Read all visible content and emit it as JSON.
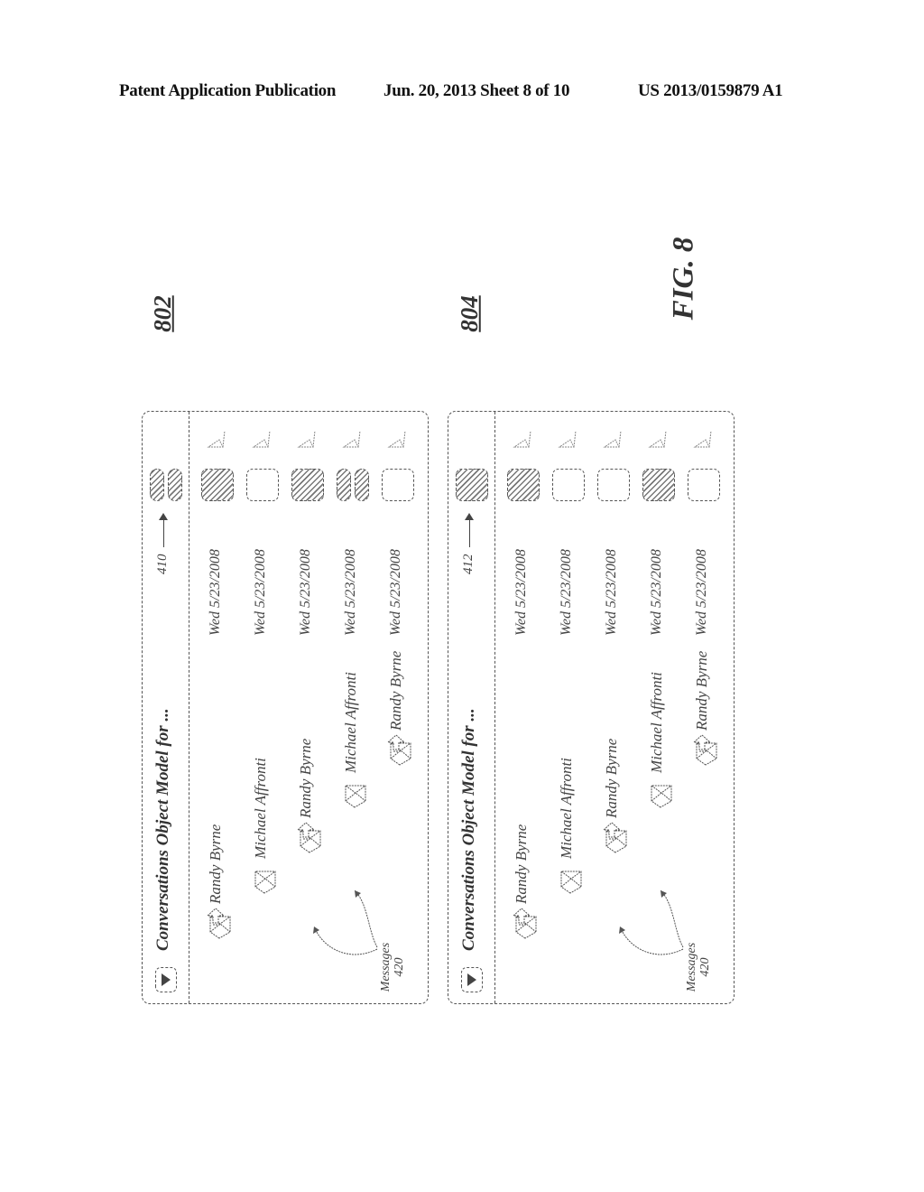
{
  "header": {
    "publication": "Patent Application Publication",
    "date_sheet": "Jun. 20, 2013   Sheet 8 of 10",
    "patent_number": "US 2013/0159879 A1"
  },
  "figure_label": "FIG. 8",
  "panels": [
    {
      "ref": "802",
      "title": "Conversations Object Model for ...",
      "category_ref": "410",
      "header_category": "double-hatched",
      "messages_label": "Messages",
      "messages_ref": "420",
      "rows": [
        {
          "icon": "envelope-reply-icon",
          "sender": "Randy Byrne",
          "date": "Wed 5/23/2008",
          "category": "hatched",
          "flag": "flag-outline"
        },
        {
          "icon": "envelope-open-icon",
          "sender": "Michael Affronti",
          "date": "Wed 5/23/2008",
          "category": "empty",
          "flag": "flag-outline"
        },
        {
          "icon": "envelope-reply-icon",
          "sender": "Randy Byrne",
          "date": "Wed 5/23/2008",
          "category": "hatched",
          "flag": "flag-outline"
        },
        {
          "icon": "envelope-open-icon",
          "sender": "Michael Affronti",
          "date": "Wed 5/23/2008",
          "category": "double-hatched",
          "flag": "flag-outline"
        },
        {
          "icon": "envelope-reply-icon",
          "sender": "Randy Byrne",
          "date": "Wed 5/23/2008",
          "category": "empty",
          "flag": "flag-outline"
        }
      ]
    },
    {
      "ref": "804",
      "title": "Conversations Object Model for ...",
      "category_ref": "412",
      "header_category": "hatched",
      "messages_label": "Messages",
      "messages_ref": "420",
      "rows": [
        {
          "icon": "envelope-reply-icon",
          "sender": "Randy Byrne",
          "date": "Wed 5/23/2008",
          "category": "hatched",
          "flag": "flag-outline"
        },
        {
          "icon": "envelope-open-icon",
          "sender": "Michael Affronti",
          "date": "Wed 5/23/2008",
          "category": "empty",
          "flag": "flag-outline"
        },
        {
          "icon": "envelope-reply-icon",
          "sender": "Randy Byrne",
          "date": "Wed 5/23/2008",
          "category": "empty",
          "flag": "flag-outline"
        },
        {
          "icon": "envelope-open-icon",
          "sender": "Michael Affronti",
          "date": "Wed 5/23/2008",
          "category": "hatched",
          "flag": "flag-outline"
        },
        {
          "icon": "envelope-reply-icon",
          "sender": "Randy Byrne",
          "date": "Wed 5/23/2008",
          "category": "empty",
          "flag": "flag-outline"
        }
      ]
    }
  ]
}
